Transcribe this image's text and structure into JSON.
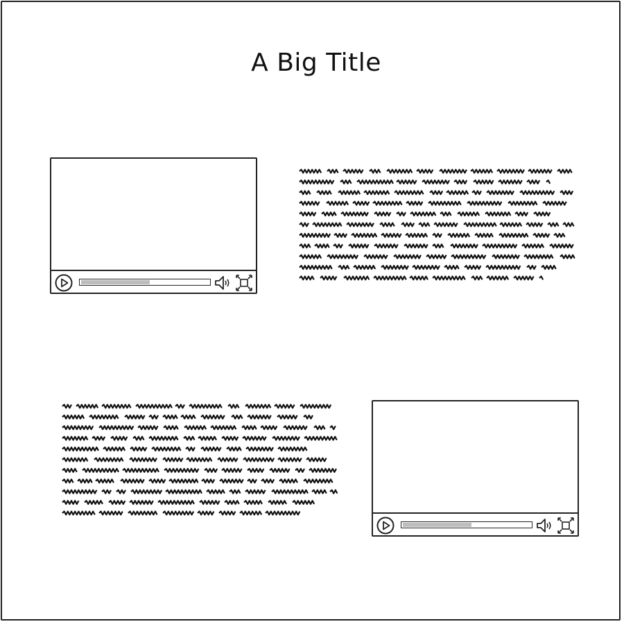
{
  "page": {
    "title": "A Big Title"
  },
  "videos": [
    {
      "progress": 0.55
    },
    {
      "progress": 0.55
    }
  ],
  "icons": {
    "play": "play-icon",
    "volume": "speaker-icon",
    "fullscreen": "fullscreen-icon"
  },
  "colors": {
    "stroke": "#222222",
    "progress_fill": "#bdbdbd",
    "background": "#ffffff"
  }
}
